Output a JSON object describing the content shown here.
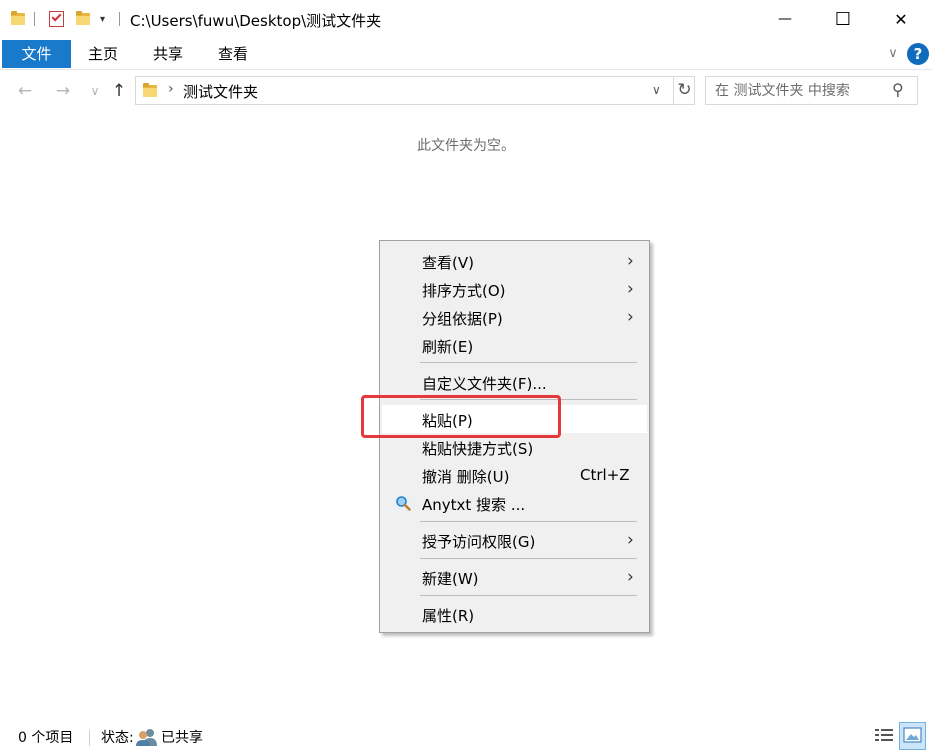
{
  "title_bar": {
    "path": "C:\\Users\\fuwu\\Desktop\\测试文件夹",
    "minimize_glyph": "—",
    "maximize_glyph": "☐",
    "close_glyph": "✕",
    "quick_access_dropdown_glyph": "▾"
  },
  "ribbon": {
    "tabs": [
      {
        "label": "文件",
        "active": true
      },
      {
        "label": "主页"
      },
      {
        "label": "共享"
      },
      {
        "label": "查看"
      }
    ],
    "expand_glyph": "∨",
    "help_glyph": "?"
  },
  "nav": {
    "back_glyph": "←",
    "forward_glyph": "→",
    "recent_glyph": "∨",
    "up_glyph": "↑",
    "breadcrumb_separator": "›",
    "current_folder": "测试文件夹",
    "dropdown_glyph": "∨",
    "refresh_glyph": "↻"
  },
  "search": {
    "placeholder": "在 测试文件夹 中搜索",
    "icon_glyph": "⚲"
  },
  "content": {
    "empty_message": "此文件夹为空。"
  },
  "context_menu": {
    "items": [
      {
        "label": "查看(V)",
        "submenu": true
      },
      {
        "label": "排序方式(O)",
        "submenu": true
      },
      {
        "label": "分组依据(P)",
        "submenu": true
      },
      {
        "label": "刷新(E)"
      },
      {
        "label": "自定义文件夹(F)..."
      },
      {
        "label": "粘贴(P)",
        "highlighted": true
      },
      {
        "label": "粘贴快捷方式(S)"
      },
      {
        "label": "撤消 删除(U)",
        "shortcut": "Ctrl+Z"
      },
      {
        "label": "Anytxt 搜索 ...",
        "icon": "anytxt-search-icon"
      },
      {
        "label": "授予访问权限(G)",
        "submenu": true
      },
      {
        "label": "新建(W)",
        "submenu": true
      },
      {
        "label": "属性(R)"
      }
    ],
    "submenu_glyph": "›",
    "annotation_color": "#e5383b"
  },
  "status_bar": {
    "item_count": "0 个项目",
    "state_label": "状态:",
    "state_value": "已共享"
  },
  "colors": {
    "file_tab": "#1979ca",
    "help": "#0f6cbd",
    "folder": "#f8d775",
    "menu_bg": "#f0f0f0"
  }
}
